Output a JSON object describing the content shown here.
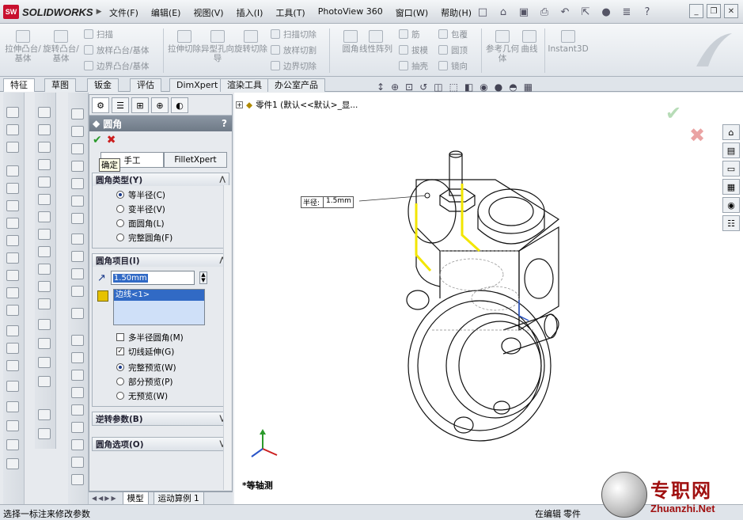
{
  "app": {
    "logo": "SW",
    "name": "SOLIDWORKS"
  },
  "menu": [
    "文件(F)",
    "编辑(E)",
    "视图(V)",
    "插入(I)",
    "工具(T)",
    "PhotoView 360",
    "窗口(W)",
    "帮助(H)"
  ],
  "ribbon": {
    "big_buttons": [
      "拉伸凸台/基体",
      "旋转凸台/基体",
      "拉伸切除",
      "异型孔向导",
      "旋转切除",
      "圆角",
      "线性阵列",
      "参考几何体",
      "曲线",
      "Instant3D"
    ],
    "small_buttons": [
      "扫描",
      "放样凸台/基体",
      "边界凸台/基体",
      "扫描切除",
      "放样切割",
      "边界切除",
      "筋",
      "拔模",
      "抽壳",
      "包覆",
      "圆顶",
      "镜向"
    ]
  },
  "command_tabs": [
    "特征",
    "草图",
    "钣金",
    "评估",
    "DimXpert",
    "渲染工具",
    "办公室产品"
  ],
  "property_manager": {
    "title": "圆角",
    "help": "?",
    "ok_tooltip": "确定",
    "mode_tabs": [
      "手工",
      "FilletXpert"
    ],
    "fillet_type": {
      "header": "圆角类型(Y)",
      "options": [
        "等半径(C)",
        "变半径(V)",
        "面圆角(L)",
        "完整圆角(F)"
      ],
      "selected": "等半径(C)"
    },
    "fillet_items": {
      "header": "圆角项目(I)",
      "radius_value": "1.50mm",
      "selection": "边线<1>",
      "multi_radius": "多半径圆角(M)",
      "multi_radius_checked": false,
      "tangent_propagation": "切线延伸(G)",
      "tangent_propagation_checked": true,
      "preview_options": [
        "完整预览(W)",
        "部分预览(P)",
        "无预览(W)"
      ],
      "preview_selected": "完整预览(W)"
    },
    "setback": {
      "header": "逆转参数(B)"
    },
    "fillet_options": {
      "header": "圆角选项(O)"
    }
  },
  "bottom_tabs": [
    "模型",
    "运动算例 1"
  ],
  "graphics": {
    "tree_root": "零件1 (默认<<默认>_显...",
    "dim_label": "半径:",
    "dim_value": "1.5mm",
    "view_name": "*等轴测",
    "highlight_color": "#f2e600"
  },
  "status": {
    "message": "选择一标注来修改参数",
    "editing": "在编辑",
    "mode": "零件"
  },
  "watermark": {
    "cn": "专职网",
    "en": "Zhuanzhi.Net"
  }
}
